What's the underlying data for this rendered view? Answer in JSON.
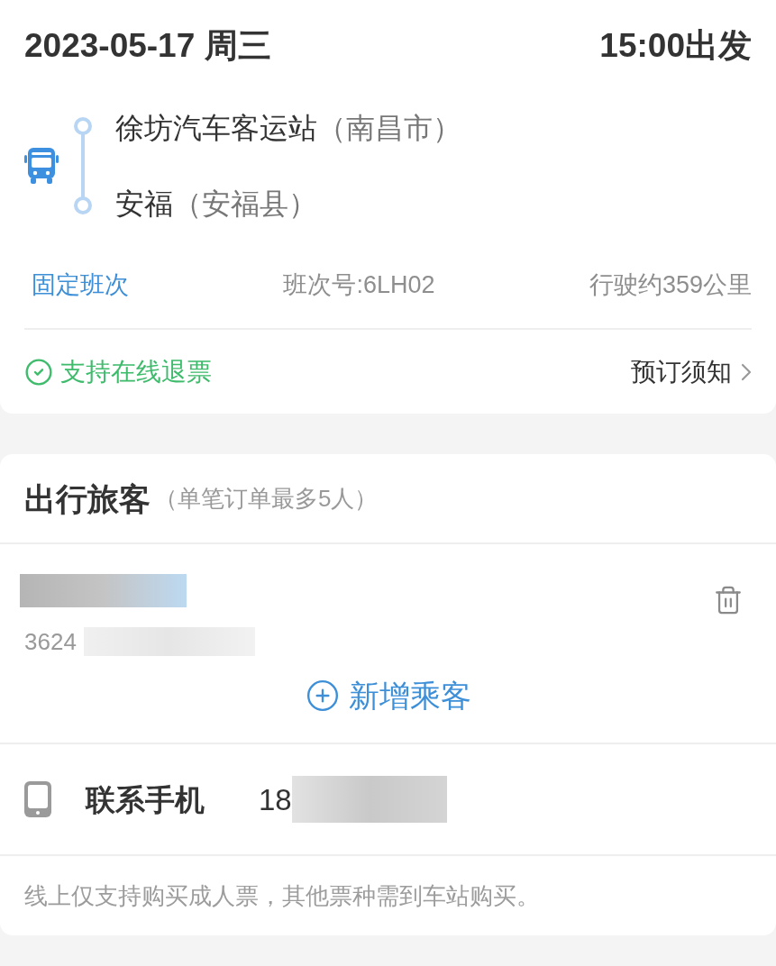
{
  "trip": {
    "date": "2023-05-17 周三",
    "departure": "15:00出发",
    "stops": [
      {
        "name": "徐坊汽车客运站",
        "region": "（南昌市）"
      },
      {
        "name": "安福",
        "region": "（安福县）"
      }
    ],
    "schedule_type": "固定班次",
    "schedule_number": "班次号:6LH02",
    "distance": "行驶约359公里",
    "refund": "支持在线退票",
    "booking_notice": "预订须知"
  },
  "passengers": {
    "title": "出行旅客",
    "limit": "（单笔订单最多5人）",
    "items": [
      {
        "number": "3624"
      }
    ],
    "add_button": "新增乘客"
  },
  "contact": {
    "label": "联系手机",
    "phone": "18"
  },
  "note": "线上仅支持购买成人票，其他票种需到车站购买。"
}
